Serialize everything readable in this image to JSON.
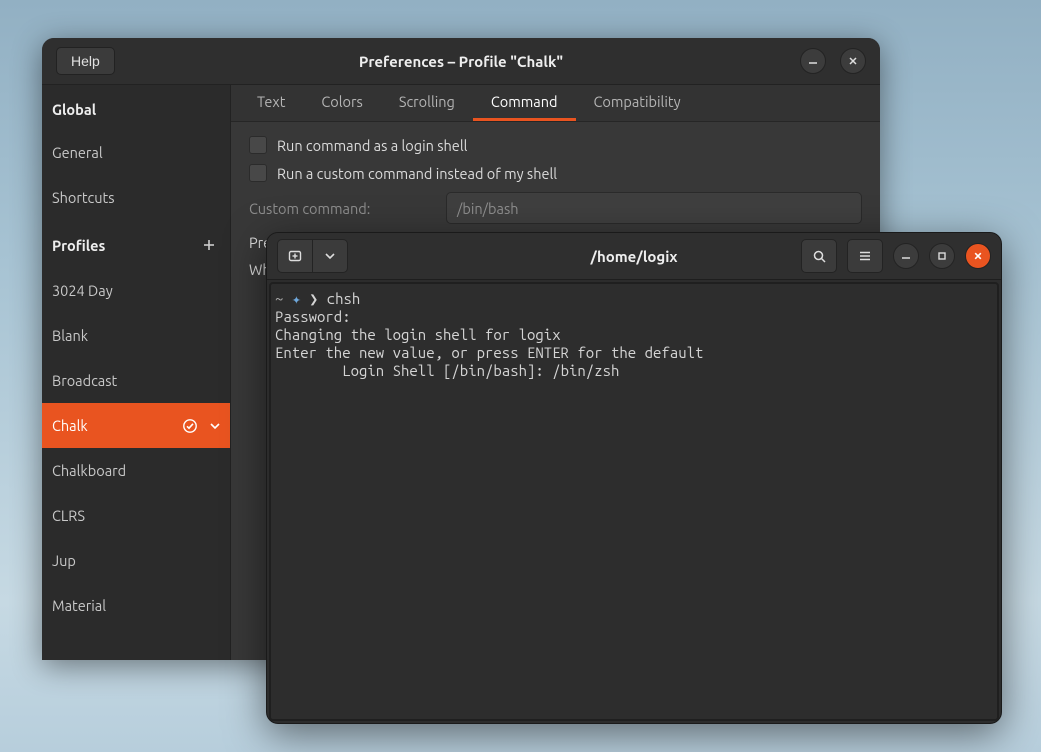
{
  "prefs": {
    "title": "Preferences – Profile \"Chalk\"",
    "help_label": "Help",
    "sidebar": {
      "global_heading": "Global",
      "global_items": [
        "General",
        "Shortcuts"
      ],
      "profiles_heading": "Profiles",
      "profiles": [
        "3024 Day",
        "Blank",
        "Broadcast",
        "Chalk",
        "Chalkboard",
        "CLRS",
        "Jup",
        "Material"
      ],
      "active_profile_index": 3
    },
    "tabs": [
      "Text",
      "Colors",
      "Scrolling",
      "Command",
      "Compatibility"
    ],
    "active_tab_index": 3,
    "command": {
      "login_shell_label": "Run command as a login shell",
      "custom_cmd_label": "Run a custom command instead of my shell",
      "custom_cmd_row_label": "Custom command:",
      "custom_cmd_value": "/bin/bash",
      "preserve_label_truncated": "Pre",
      "when_label_truncated": "Wh"
    }
  },
  "terminal": {
    "title": "/home/logix",
    "lines": [
      {
        "prompt": true,
        "cmd": "chsh"
      },
      {
        "text": "Password:"
      },
      {
        "text": "Changing the login shell for logix"
      },
      {
        "text": "Enter the new value, or press ENTER for the default"
      },
      {
        "text": "        Login Shell [/bin/bash]: /bin/zsh"
      }
    ]
  },
  "colors": {
    "accent": "#e95420",
    "bg_dark": "#2b2b2b",
    "bg_panel": "#383838",
    "term_bg": "#2d2d2d"
  }
}
